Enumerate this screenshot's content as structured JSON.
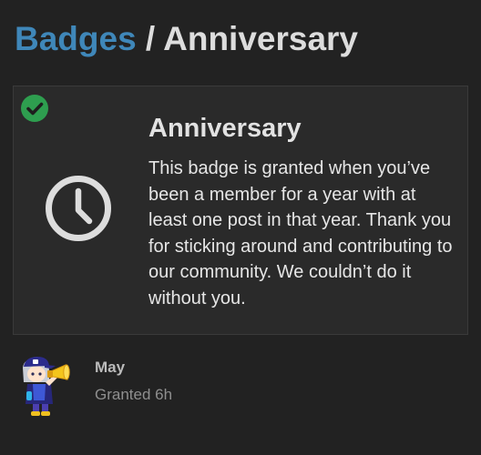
{
  "breadcrumb": {
    "parent": "Badges",
    "separator": " / ",
    "current": "Anniversary"
  },
  "badge": {
    "title": "Anniversary",
    "description": "This badge is granted when you’ve been a member for a year with at least one post in that year. Thank you for sticking around and contributing to our community. We couldn’t do it without you.",
    "icon": "clock-icon",
    "status_icon": "check-circle-icon"
  },
  "grant": {
    "username": "May",
    "granted": "Granted 6h"
  },
  "colors": {
    "background": "#222222",
    "link": "#3f87b9",
    "check": "#2e9e4f",
    "card": "#2a2a2a"
  }
}
